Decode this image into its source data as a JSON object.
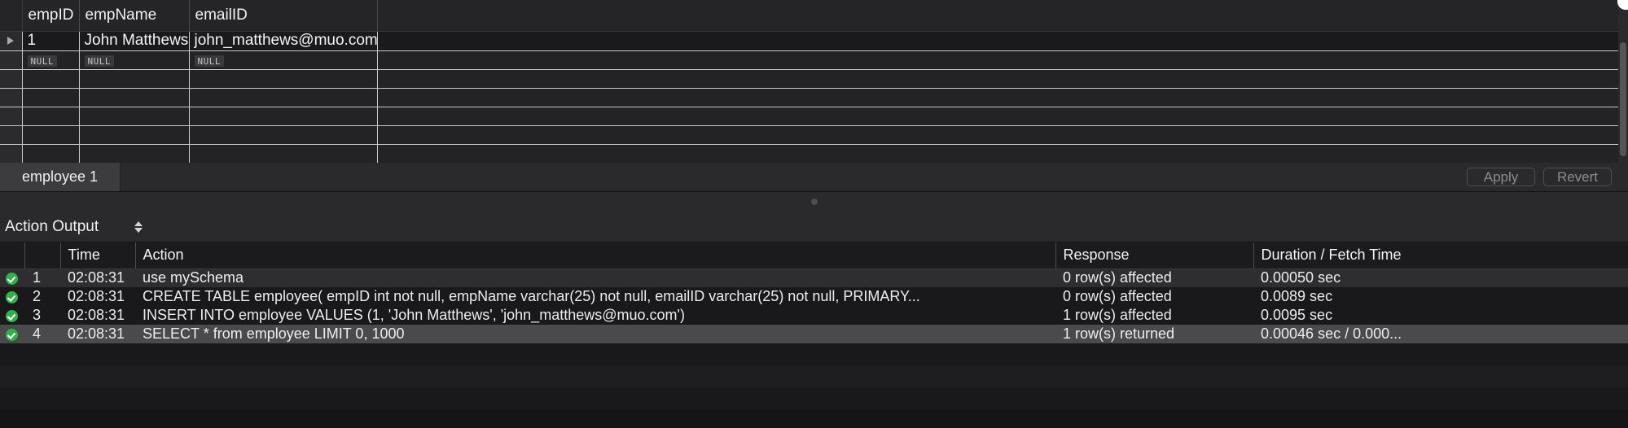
{
  "result_grid": {
    "columns": [
      {
        "key": "handle",
        "label": ""
      },
      {
        "key": "empID",
        "label": "empID"
      },
      {
        "key": "empName",
        "label": "empName"
      },
      {
        "key": "emailID",
        "label": "emailID"
      },
      {
        "key": "filler",
        "label": ""
      }
    ],
    "rows": [
      {
        "type": "data",
        "marker": "row-selected-marker",
        "empID": "1",
        "empName": "John Matthews",
        "emailID": "john_matthews@muo.com"
      },
      {
        "type": "null",
        "empID": "NULL",
        "empName": "NULL",
        "emailID": "NULL"
      },
      {
        "type": "empty"
      },
      {
        "type": "empty"
      },
      {
        "type": "empty"
      },
      {
        "type": "empty"
      },
      {
        "type": "empty"
      }
    ]
  },
  "editor_bar": {
    "tab_label": "employee 1",
    "apply_label": "Apply",
    "revert_label": "Revert"
  },
  "output_selector": {
    "label": "Action Output"
  },
  "action_output": {
    "headers": {
      "icon": "",
      "num": "",
      "time": "Time",
      "action": "Action",
      "response": "Response",
      "duration": "Duration / Fetch Time"
    },
    "rows": [
      {
        "status": "success",
        "num": "1",
        "time": "02:08:31",
        "action": "use mySchema",
        "response": "0 row(s) affected",
        "duration": "0.00050 sec"
      },
      {
        "status": "success",
        "num": "2",
        "time": "02:08:31",
        "action": "CREATE TABLE employee(    empID int not null,    empName varchar(25) not null,    emailID varchar(25) not null,    PRIMARY...",
        "response": "0 row(s) affected",
        "duration": "0.0089 sec"
      },
      {
        "status": "success",
        "num": "3",
        "time": "02:08:31",
        "action": "INSERT INTO employee  VALUES (1, 'John Matthews', 'john_matthews@muo.com')",
        "response": "1 row(s) affected",
        "duration": "0.0095 sec"
      },
      {
        "status": "success",
        "num": "4",
        "time": "02:08:31",
        "action": "SELECT * from employee LIMIT 0, 1000",
        "response": "1 row(s) returned",
        "duration": "0.00046 sec / 0.000..."
      }
    ]
  },
  "colors": {
    "window_background": "#1c1c1e",
    "grid_background": "#1d1d1f",
    "grid_line": "#c9c9cc",
    "toolbar_background": "#2a2a2c",
    "active_tab": "#3c3c3f",
    "selected_row": "#4a4a4d",
    "success_green": "#31b14a",
    "text_primary": "#f0f0f0",
    "text_muted": "#8c8c90"
  }
}
